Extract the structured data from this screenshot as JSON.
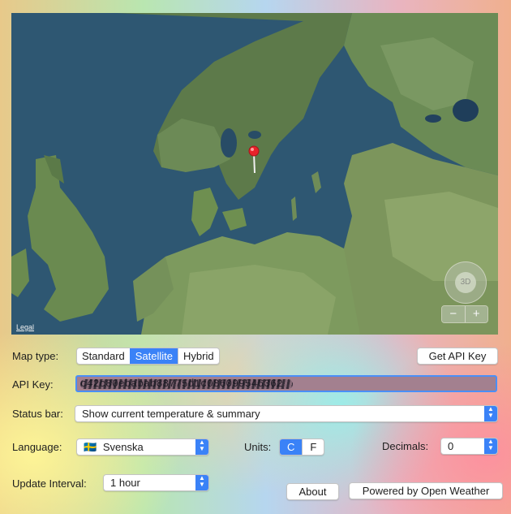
{
  "map": {
    "legal_label": "Legal",
    "compass_label": "3D",
    "zoom_out": "−",
    "zoom_in": "+"
  },
  "map_type": {
    "label": "Map type:",
    "options": [
      "Standard",
      "Satellite",
      "Hybrid"
    ],
    "selected": "Satellite"
  },
  "get_api_key_label": "Get API Key",
  "api_key": {
    "label": "API Key:",
    "value": "c42c80ebabab88775d1c086099546362"
  },
  "status_bar": {
    "label": "Status bar:",
    "value": "Show current temperature & summary"
  },
  "language": {
    "label": "Language:",
    "flag": "🇸🇪",
    "value": "Svenska"
  },
  "units": {
    "label": "Units:",
    "options": [
      "C",
      "F"
    ],
    "selected": "C"
  },
  "decimals": {
    "label": "Decimals:",
    "value": "0"
  },
  "update_interval": {
    "label": "Update Interval:",
    "value": "1 hour"
  },
  "about_label": "About",
  "powered_label": "Powered by Open Weather",
  "colors": {
    "accent": "#3a82f7",
    "pin": "#e8222a"
  }
}
